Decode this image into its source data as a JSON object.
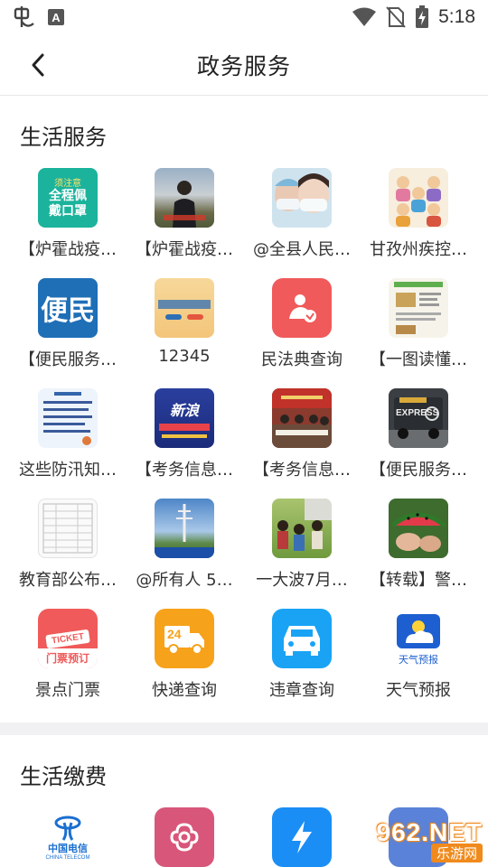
{
  "status": {
    "time": "5:18",
    "app_letter": "A"
  },
  "header": {
    "title": "政务服务"
  },
  "life_services": {
    "title": "生活服务",
    "items": [
      {
        "label": "【炉霍战疫…",
        "icon": "mask-poster-thumb",
        "icon_text": "全程佩戴口罩",
        "icon_top": "须注意"
      },
      {
        "label": "【炉霍战疫…",
        "icon": "person-photo-thumb"
      },
      {
        "label": "@全县人民…",
        "icon": "medical-staff-photo-thumb"
      },
      {
        "label": "甘孜州疾控…",
        "icon": "cartoon-people-thumb"
      },
      {
        "label": "【便民服务…",
        "icon": "bianmin-thumb",
        "icon_text": "便民"
      },
      {
        "label": "12345",
        "icon": "hotline-banner-thumb"
      },
      {
        "label": "民法典查询",
        "icon": "civil-code-icon"
      },
      {
        "label": "【一图读懂…",
        "icon": "infographic-thumb"
      },
      {
        "label": "这些防汛知…",
        "icon": "flood-notice-thumb"
      },
      {
        "label": "【考务信息…",
        "icon": "exam-banner-thumb",
        "icon_text": "新浪"
      },
      {
        "label": "【考务信息…",
        "icon": "meeting-photo-thumb"
      },
      {
        "label": "【便民服务…",
        "icon": "express-truck-thumb",
        "icon_text": "EXPRESS"
      },
      {
        "label": "教育部公布…",
        "icon": "table-document-thumb"
      },
      {
        "label": "@所有人 5…",
        "icon": "tower-photo-thumb"
      },
      {
        "label": "一大波7月…",
        "icon": "crowd-photo-thumb"
      },
      {
        "label": "【转载】警…",
        "icon": "watermelon-photo-thumb"
      },
      {
        "label": "景点门票",
        "icon": "ticket-icon",
        "icon_text": "门票预订",
        "icon_badge": "TICKET"
      },
      {
        "label": "快递查询",
        "icon": "delivery-truck-icon",
        "icon_badge": "24"
      },
      {
        "label": "违章查询",
        "icon": "car-icon"
      },
      {
        "label": "天气预报",
        "icon": "weather-icon",
        "icon_text": "天气预报"
      }
    ]
  },
  "life_payments": {
    "title": "生活缴费",
    "items": [
      {
        "icon": "china-telecom-icon",
        "icon_text": "中国电信",
        "icon_sub": "CHINA TELECOM"
      },
      {
        "icon": "china-unicom-icon"
      },
      {
        "icon": "electricity-icon"
      },
      {
        "icon": "gas-icon"
      }
    ]
  },
  "watermark": {
    "top": "962.NET",
    "bottom": "乐游网"
  },
  "colors": {
    "accent_red": "#f05a5a",
    "accent_blue": "#1aa3f5",
    "accent_orange": "#f7a21b",
    "divider": "#f1f1f3"
  }
}
